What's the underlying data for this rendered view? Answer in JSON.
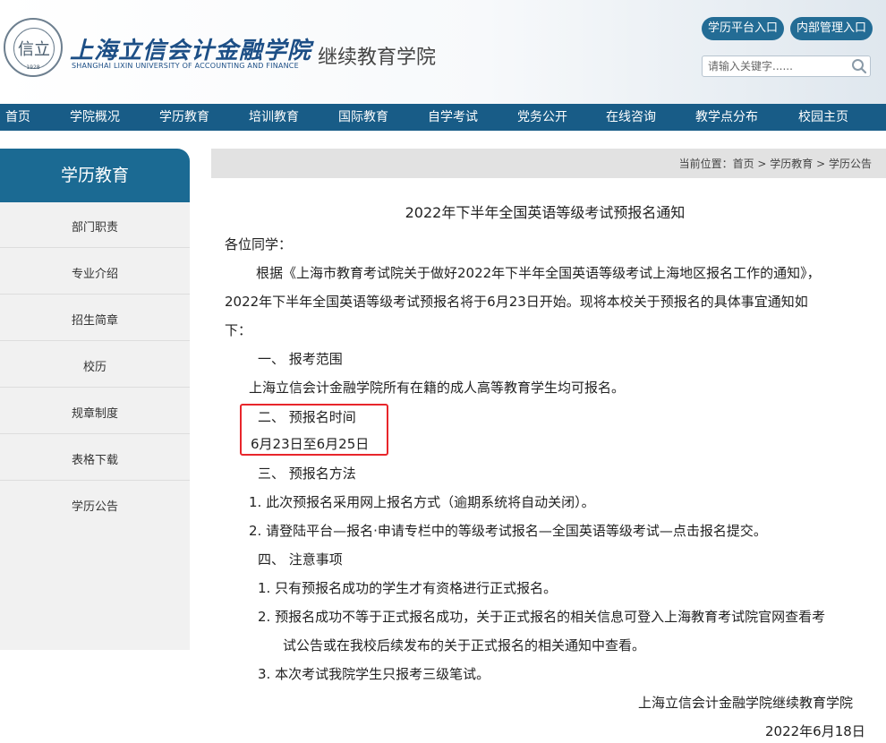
{
  "header": {
    "seal_char": "信立",
    "seal_year": "1928",
    "logo_cn": "上海立信会计金融学院",
    "logo_en": "SHANGHAI LIXIN UNIVERSITY OF ACCOUNTING AND FINANCE",
    "college": "继续教育学院",
    "btn_degree_platform": "学历平台入口",
    "btn_internal": "内部管理入口",
    "search_placeholder": "请输入关键字......"
  },
  "nav": [
    "首页",
    "学院概况",
    "学历教育",
    "培训教育",
    "国际教育",
    "自学考试",
    "党务公开",
    "在线咨询",
    "教学点分布",
    "校园主页"
  ],
  "sidebar": {
    "title": "学历教育",
    "items": [
      "部门职责",
      "专业介绍",
      "招生简章",
      "校历",
      "规章制度",
      "表格下载",
      "学历公告"
    ]
  },
  "breadcrumb": {
    "prefix": "当前位置：",
    "items": [
      "首页",
      "学历教育",
      "学历公告"
    ],
    "sep": " > "
  },
  "article": {
    "title": "2022年下半年全国英语等级考试预报名通知",
    "greeting": "各位同学：",
    "para1_line1": "根据《上海市教育考试院关于做好2022年下半年全国英语等级考试上海地区报名工作的通知》，",
    "para1_line2": "2022年下半年全国英语等级考试预报名将于6月23日开始。现将本校关于预报名的具体事宜通知如",
    "para1_line3": "下：",
    "sec1_heading": "一、 报考范围",
    "sec1_body": "上海立信会计金融学院所有在籍的成人高等教育学生均可报名。",
    "sec2_heading": "二、 预报名时间",
    "sec2_body": "6月23日至6月25日",
    "sec3_heading": "三、 预报名方法",
    "sec3_item1": "1. 此次预报名采用网上报名方式（逾期系统将自动关闭）。",
    "sec3_item2": "2. 请登陆平台—报名·申请专栏中的等级考试报名—全国英语等级考试—点击报名提交。",
    "sec4_heading": "四、 注意事项",
    "sec4_item1": "1. 只有预报名成功的学生才有资格进行正式报名。",
    "sec4_item2_line1": "2. 预报名成功不等于正式报名成功，关于正式报名的相关信息可登入上海教育考试院官网查看考",
    "sec4_item2_line2": "试公告或在我校后续发布的关于正式报名的相关通知中查看。",
    "sec4_item3": "3. 本次考试我院学生只报考三级笔试。",
    "signature": "上海立信会计金融学院继续教育学院",
    "date": "2022年6月18日"
  },
  "colors": {
    "nav_bg": "#185c87",
    "sidebar_title_bg": "#1b6a93",
    "portal_btn_bg": "#236c95",
    "highlight_border": "#e8262b"
  }
}
